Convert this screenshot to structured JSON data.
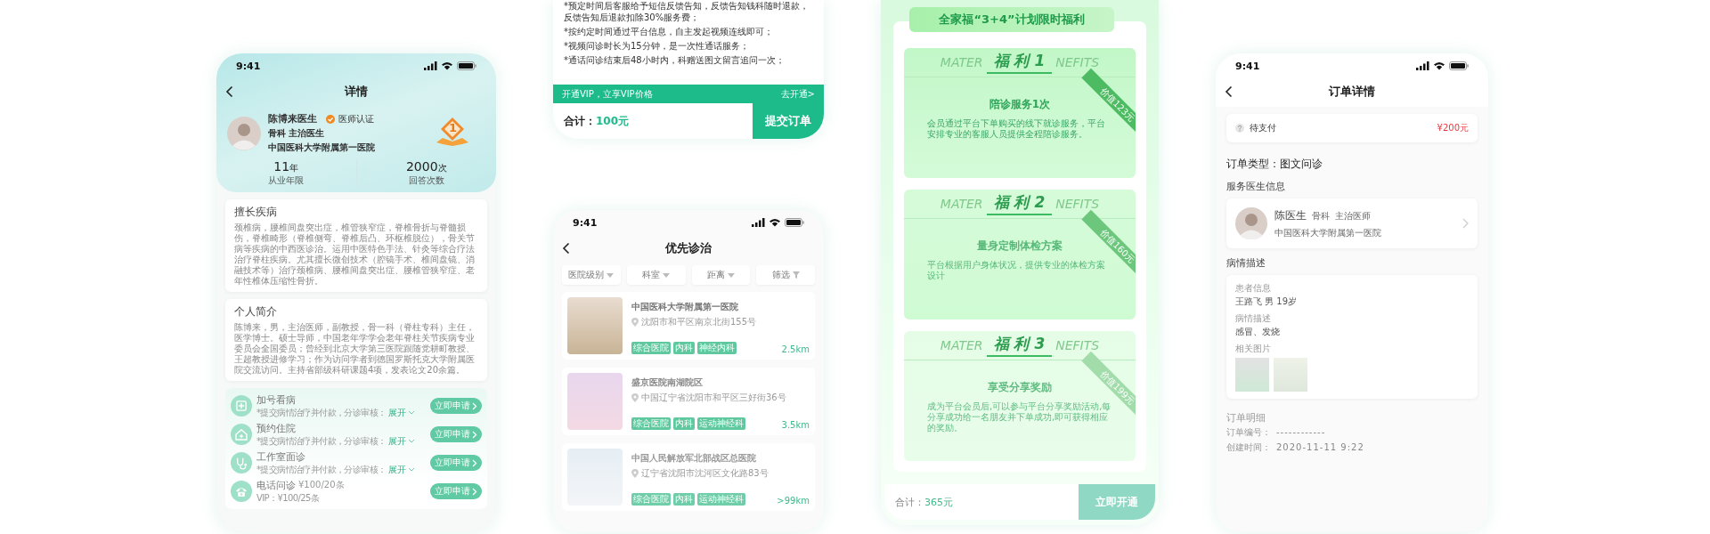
{
  "doctor_detail": {
    "status_bar": {
      "time": "9:41"
    },
    "title": "详情",
    "doctor": {
      "name": "陈博来医生",
      "badge": "医师认证",
      "department": "骨科 主治医生",
      "hospital": "中国医科大学附属第一医院",
      "rank": "1"
    },
    "stats": [
      {
        "value": "11",
        "unit": "年",
        "label": "从业年限"
      },
      {
        "value": "2000",
        "unit": "次",
        "label": "回答次数"
      }
    ],
    "specialty": {
      "title": "擅长疾病",
      "text": "颈椎病，腰椎间盘突出症，椎管狭窄症，脊椎骨折与脊髓损伤，脊椎畸形（脊椎侧弯、脊椎后凸、环枢椎脱位），骨关节病等疾病的中西医诊治。运用中医特色手法、针灸等综合疗法治疗脊柱疾病。尤其擅长微创技术（腔镜手术、椎间盘镜、消融技术等）治疗颈椎病、腰椎间盘突出症、腰椎管狭窄症、老年性椎体压缩性骨折。"
    },
    "intro": {
      "title": "个人简介",
      "text": "陈博来，男，主治医师，副教授，骨一科（脊柱专科）主任，医学博士。硕士导师，中国老年学学会老年脊柱关节疾病专业委员会全国委员；曾经到北京大学第三医院跟随党耕町教授、王超教授进修学习；作为访问学者到德国罗斯托克大学附属医院交流访问。主持省部级科研课题4项，发表论文20余篇。"
    },
    "services": [
      {
        "kind": "review",
        "name": "加号看病",
        "note": "*提交病情治疗并付款，分诊审核：",
        "expand": "展开",
        "button": "立即申请"
      },
      {
        "kind": "review",
        "name": "预约住院",
        "note": "*提交病情治疗并付款，分诊审核：",
        "expand": "展开",
        "button": "立即申请"
      },
      {
        "kind": "review",
        "name": "工作室面诊",
        "note": "*提交病情治疗并付款，分诊审核：",
        "expand": "展开",
        "button": "立即申请"
      },
      {
        "kind": "priced",
        "name": "电话问诊",
        "price": "¥100/20条",
        "vip_price": "VIP：¥100/25条",
        "button": "立即申请"
      }
    ]
  },
  "order_confirm": {
    "notes": [
      "*预定时间后客服给予短信反馈告知，反馈告知钱科随时退款，反馈告知后退款扣除30%服务费；",
      "*按约定时间通过平台信息，自主发起视频连线即可；",
      "*视频问诊时长为15分钟，是一次性通话服务；",
      "*通话问诊结束后48小时内，科赠送图文留言追问一次；"
    ],
    "vip_bar": {
      "text": "开通VIP，立享VIP价格",
      "link": "去开通>"
    },
    "total_label": "合计：",
    "total": "100元",
    "submit": "提交订单"
  },
  "hospital_list": {
    "status_bar": {
      "time": "9:41"
    },
    "title": "优先诊治",
    "filters": [
      {
        "kind": "dropdown",
        "label": "医院级别"
      },
      {
        "kind": "dropdown",
        "label": "科室"
      },
      {
        "kind": "dropdown",
        "label": "距离"
      },
      {
        "kind": "filter",
        "label": "筛选"
      }
    ],
    "hospitals": [
      {
        "name": "中国医科大学附属第一医院",
        "address": "沈阳市和平区南京北街155号",
        "tags": [
          "综合医院",
          "内科",
          "神经内科"
        ],
        "distance": "2.5km"
      },
      {
        "name": "盛京医院南湖院区",
        "address": "中国辽宁省沈阳市和平区三好街36号",
        "tags": [
          "综合医院",
          "内科",
          "运动神经科"
        ],
        "distance": "3.5km"
      },
      {
        "name": "中国人民解放军北部战区总医院",
        "address": "辽宁省沈阳市沈河区文化路83号",
        "tags": [
          "综合医院",
          "内科",
          "运动神经科"
        ],
        "distance": ">99km"
      }
    ]
  },
  "benefits": {
    "banner": "全家福“3+4”计划限时福利",
    "items": [
      {
        "label": "福 利 1",
        "watermark_left": "MATER",
        "watermark_right": "NEFITS",
        "value_tag": "价值123元",
        "title": "陪诊服务1次",
        "text": "会员通过平台下单购买的线下就诊服务，平台安排专业的客服人员提供全程陪诊服务。"
      },
      {
        "label": "福 利 2",
        "watermark_left": "MATER",
        "watermark_right": "NEFITS",
        "value_tag": "价值160元",
        "title": "量身定制体检方案",
        "text": "平台根据用户身体状况，提供专业的体检方案设计"
      },
      {
        "label": "福 利 3",
        "watermark_left": "MATER",
        "watermark_right": "NEFITS",
        "value_tag": "价值199元",
        "title": "享受分享奖励",
        "text": "成为平台会员后,可以参与平台分享奖励活动,每分享成功给一名朋友并下单成功,即可获得相应的奖励。"
      }
    ],
    "total_label": "合计：",
    "total": "365元",
    "submit": "立即开通"
  },
  "order_detail": {
    "status_bar": {
      "time": "9:41"
    },
    "title": "订单详情",
    "status": {
      "text": "待支付",
      "amount": "¥200元"
    },
    "order_type": "订单类型：图文问诊",
    "doctor_section": "服务医生信息",
    "doctor": {
      "name": "陈医生",
      "department": "骨科",
      "title": "主治医师",
      "hospital": "中国医科大学附属第一医院"
    },
    "condition_section": "病情描述",
    "condition": [
      {
        "label": "患者信息",
        "value": "王路飞  男  19岁"
      },
      {
        "label": "病情描述",
        "value": "感冒、发烧"
      }
    ],
    "photos_label": "相关图片",
    "details_title": "订单明细",
    "details": [
      {
        "label": "订单编号：",
        "value": "------------"
      },
      {
        "label": "创建时间：",
        "value": "2020-11-11 9:22"
      }
    ]
  }
}
